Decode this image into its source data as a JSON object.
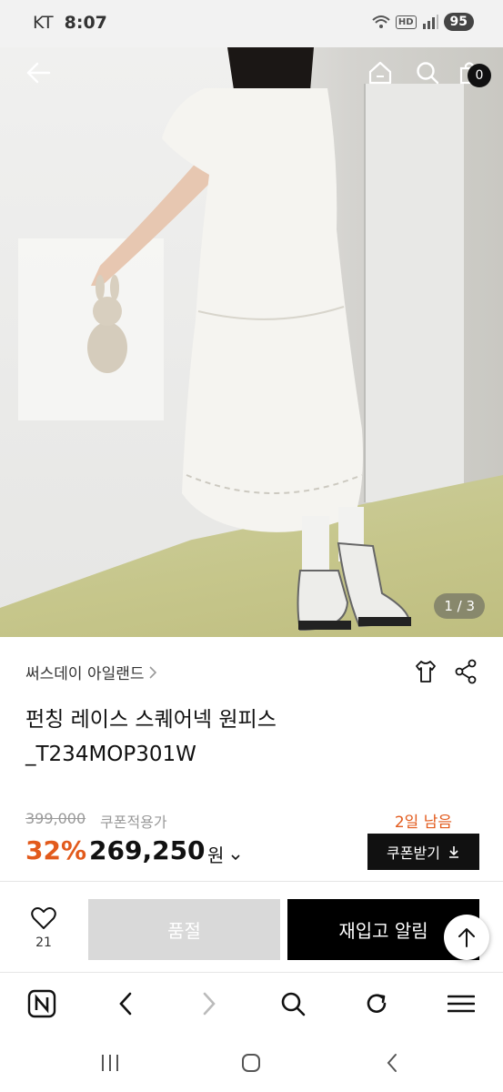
{
  "status_bar": {
    "carrier": "KT",
    "time": "8:07",
    "network": "HD",
    "battery": "95"
  },
  "header": {
    "back_icon": "arrow-left-icon",
    "home_icon": "home-icon",
    "search_icon": "search-icon",
    "cart_icon": "shopping-bag-icon",
    "cart_count": "0"
  },
  "gallery": {
    "page_indicator": "1 / 3",
    "current": 1,
    "total": 3
  },
  "product": {
    "brand": "써스데이 아일랜드",
    "title_line1": "펀칭 레이스 스퀘어넥 원피스",
    "title_line2": "_T234MOP301W",
    "original_price": "399,000",
    "coupon_applied_label": "쿠폰적용가",
    "discount": "32%",
    "price": "269,250",
    "price_unit": "원",
    "days_left": "2일 남음",
    "coupon_button": "쿠폰받기"
  },
  "purchase_bar": {
    "wish_count": "21",
    "soldout_label": "품절",
    "restock_label": "재입고 알림"
  },
  "colors": {
    "accent": "#e25a1c",
    "primary": "#000000",
    "disabled": "#d9d9d9"
  }
}
